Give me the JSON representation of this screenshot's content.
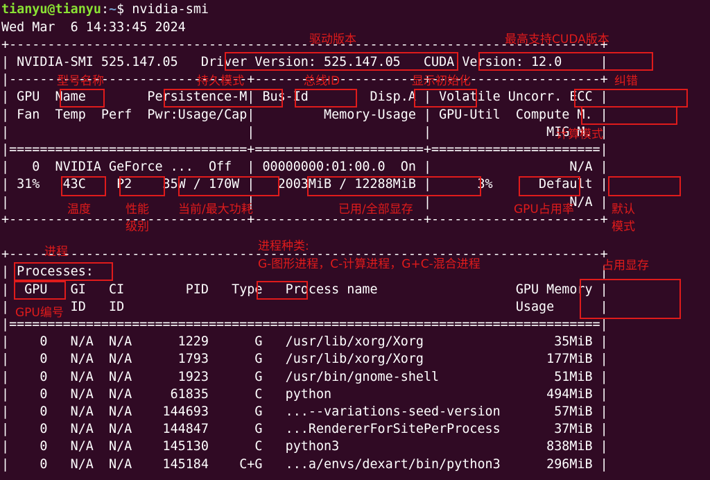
{
  "terminal": {
    "prompt_user": "tianyu@tianyu",
    "prompt_sep": ":",
    "prompt_path": "~",
    "prompt_end": "$ ",
    "command": "nvidia-smi",
    "lines": [
      "Wed Mar  6 14:33:45 2024",
      "+-----------------------------------------------------------------------------+",
      "| NVIDIA-SMI 525.147.05   Driver Version: 525.147.05   CUDA Version: 12.0     |",
      "|-------------------------------+----------------------+----------------------+",
      "| GPU  Name        Persistence-M| Bus-Id        Disp.A | Volatile Uncorr. ECC |",
      "| Fan  Temp  Perf  Pwr:Usage/Cap|         Memory-Usage | GPU-Util  Compute M. |",
      "|                               |                      |               MIG M. |",
      "|===============================+======================+======================|",
      "|   0  NVIDIA GeForce ...  Off  | 00000000:01:00.0  On |                  N/A |",
      "| 31%   43C    P2    35W / 170W |   2003MiB / 12288MiB |      3%      Default |",
      "|                               |                      |                  N/A |",
      "+-------------------------------+----------------------+----------------------+",
      "",
      "+-----------------------------------------------------------------------------+",
      "| Processes:                                                                  |",
      "|  GPU   GI   CI        PID   Type   Process name                  GPU Memory |",
      "|        ID   ID                                                   Usage      |",
      "|=============================================================================|",
      "|    0   N/A  N/A      1229      G   /usr/lib/xorg/Xorg                 35MiB |",
      "|    0   N/A  N/A      1793      G   /usr/lib/xorg/Xorg                177MiB |",
      "|    0   N/A  N/A      1923      G   /usr/bin/gnome-shell               51MiB |",
      "|    0   N/A  N/A     61835      C   python                            494MiB |",
      "|    0   N/A  N/A    144693      G   ...--variations-seed-version       57MiB |",
      "|    0   N/A  N/A    144847      G   ...RendererForSitePerProcess       37MiB |",
      "|    0   N/A  N/A    145130      C   python3                           838MiB |",
      "|    0   N/A  N/A    145184    C+G   ...a/envs/dexart/bin/python3      296MiB |"
    ]
  },
  "annotations": {
    "driver_version": "驱动版本",
    "cuda_version": "最高支持CUDA版本",
    "name": "型号名称",
    "persistence": "持久模式",
    "bus_id": "总线ID",
    "disp": "显示初始化",
    "ecc": "纠错",
    "compute_mode": "计算模式",
    "temp": "温度",
    "perf_1": "性能",
    "perf_2": "级别",
    "power": "当前/最大功耗",
    "memory": "已用/全部显存",
    "gpu_util": "GPU占用率",
    "default_1": "默认",
    "default_2": "模式",
    "processes": "进程",
    "type_1": "进程种类:",
    "type_2": "G-图形进程，C-计算进程，G+C-混合进程",
    "gpu_memory": "占用显存",
    "gpu_id": "GPU编号"
  },
  "colors": {
    "background": "#300a24",
    "text": "#ffffff",
    "prompt_user": "#8ae234",
    "prompt_path": "#729fcf",
    "annotation": "#e01b1b"
  }
}
